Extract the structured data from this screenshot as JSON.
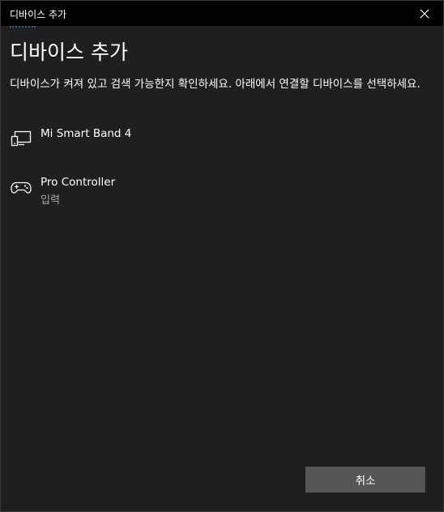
{
  "window": {
    "title": "디바이스 추가"
  },
  "main": {
    "heading": "디바이스 추가",
    "instructions": "디바이스가 켜져 있고 검색 가능한지 확인하세요. 아래에서 연결할 디바이스를 선택하세요."
  },
  "devices": [
    {
      "name": "Mi Smart Band 4",
      "subtitle": "",
      "icon": "device-icon"
    },
    {
      "name": "Pro Controller",
      "subtitle": "입력",
      "icon": "gamepad-icon"
    }
  ],
  "footer": {
    "cancel_label": "취소"
  },
  "colors": {
    "background": "#1f1f1f",
    "titlebar": "#000000",
    "button": "#555555",
    "secondary_text": "#a8a8a8"
  }
}
